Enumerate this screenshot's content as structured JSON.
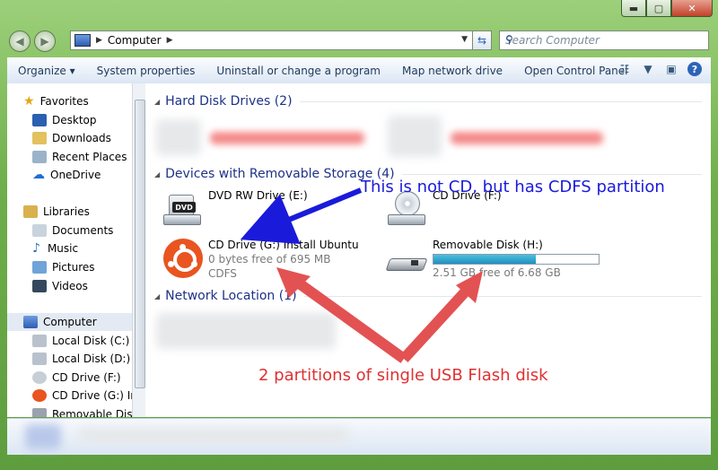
{
  "window": {
    "controls": {
      "minimize": "▬",
      "maximize": "▢",
      "close": "✕"
    }
  },
  "address_bar": {
    "path": "Computer",
    "search_placeholder": "Search Computer"
  },
  "toolbar": {
    "items": [
      "Organize ▾",
      "System properties",
      "Uninstall or change a program",
      "Map network drive",
      "Open Control Panel"
    ]
  },
  "sidebar": {
    "favorites": {
      "label": "Favorites",
      "items": [
        "Desktop",
        "Downloads",
        "Recent Places",
        "OneDrive"
      ]
    },
    "libraries": {
      "label": "Libraries",
      "items": [
        "Documents",
        "Music",
        "Pictures",
        "Videos"
      ]
    },
    "computer": {
      "label": "Computer",
      "items": [
        "Local Disk (C:)",
        "Local Disk (D:)",
        "CD Drive (F:)",
        "CD Drive (G:) Inst",
        "Removable Disk ("
      ]
    }
  },
  "groups": {
    "hdd": "Hard Disk Drives (2)",
    "removable": "Devices with Removable Storage (4)",
    "network": "Network Location (1)"
  },
  "drives": {
    "dvd": {
      "name": "DVD RW Drive (E:)",
      "icon_label": "DVD"
    },
    "cdf": {
      "name": "CD Drive (F:)"
    },
    "cdg": {
      "name": "CD Drive (G:) Install Ubuntu",
      "free": "0 bytes free of 695 MB",
      "fs": "CDFS",
      "used_fraction": 1.0
    },
    "usb": {
      "name": "Removable Disk (H:)",
      "free": "2.51 GB free of 6.68 GB",
      "used_fraction": 0.62
    }
  },
  "annotations": {
    "blue": "This is not CD, but has CDFS partition",
    "red": "2 partitions of single USB Flash disk"
  },
  "colors": {
    "annot_blue": "#1a1adb",
    "annot_red": "#e03030",
    "accent": "#1e3287"
  }
}
